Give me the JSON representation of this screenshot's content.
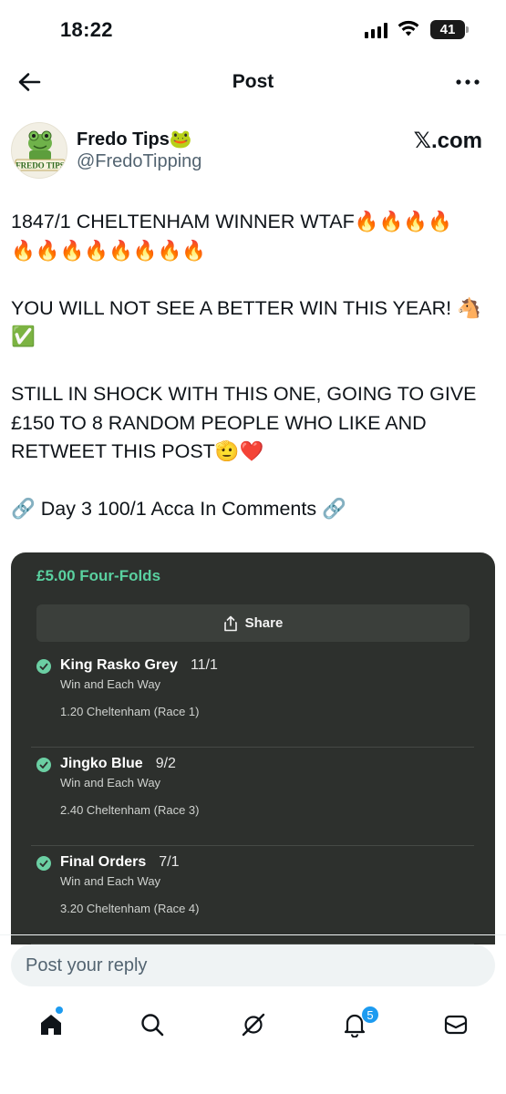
{
  "status_bar": {
    "time": "18:22",
    "battery": "41"
  },
  "header": {
    "title": "Post",
    "back_icon": "arrow-left-icon",
    "more_icon": "ellipsis-icon"
  },
  "author": {
    "name": "Fredo Tips🐸",
    "handle": "@FredoTipping",
    "avatar_text": "FREDO TIPS",
    "source": "𝕏.com"
  },
  "tweet": {
    "line1": "1847/1 CHELTENHAM WINNER WTAF🔥🔥🔥🔥",
    "line2": "🔥🔥🔥🔥🔥🔥🔥🔥",
    "line3": "YOU WILL NOT SEE A BETTER WIN THIS YEAR! 🐴",
    "line4": "✅",
    "line5": "STILL IN SHOCK WITH THIS ONE, GOING TO GIVE",
    "line6": "£150 TO 8 RANDOM PEOPLE WHO LIKE AND",
    "line7": "RETWEET THIS POST🫡❤️",
    "line8": "🔗 Day 3 100/1 Acca In Comments 🔗"
  },
  "bet_slip": {
    "title": "£5.00 Four-Folds",
    "share_label": "Share",
    "legs": [
      {
        "name": "King Rasko Grey",
        "odds": "11/1",
        "type": "Win and Each Way",
        "race": "1.20 Cheltenham (Race 1)"
      },
      {
        "name": "Jingko Blue",
        "odds": "9/2",
        "type": "Win and Each Way",
        "race": "2.40 Cheltenham (Race 3)"
      },
      {
        "name": "Final Orders",
        "odds": "7/1",
        "type": "Win and Each Way",
        "race": "3.20 Cheltenham (Race 4)"
      }
    ],
    "accent_color": "#5ad1a0"
  },
  "reply": {
    "placeholder": "Post your reply"
  },
  "tabbar": {
    "items": [
      "home-icon",
      "search-icon",
      "grok-icon",
      "notifications-icon",
      "messages-icon"
    ],
    "notification_count": "5"
  }
}
